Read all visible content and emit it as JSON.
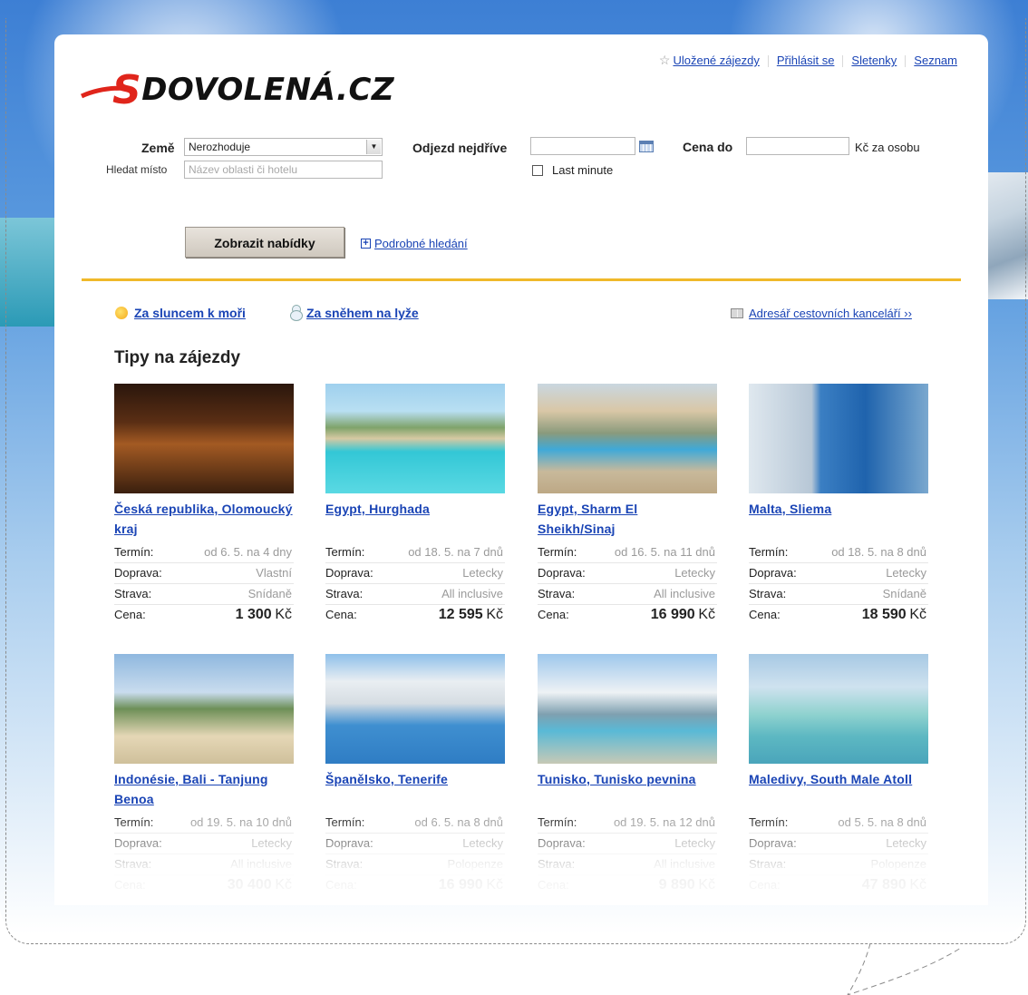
{
  "header": {
    "logo_text": "DOVOLENÁ.CZ",
    "logo_initial": "S",
    "links": [
      {
        "label": "Uložené zájezdy",
        "icon": "star-icon"
      },
      {
        "label": "Přihlásit se"
      },
      {
        "label": "Sletenky"
      },
      {
        "label": "Seznam"
      }
    ]
  },
  "search": {
    "country_label": "Země",
    "country_value": "Nerozhoduje",
    "place_label": "Hledat místo",
    "place_placeholder": "Název oblasti či hotelu",
    "departure_label": "Odjezd nejdříve",
    "departure_value": "",
    "last_minute_label": "Last minute",
    "price_label": "Cena do",
    "price_value": "",
    "price_suffix": "Kč za osobu",
    "submit_label": "Zobrazit nabídky",
    "advanced_label": "Podrobné hledání"
  },
  "categories": {
    "sun": "Za sluncem k moři",
    "snow": "Za sněhem na lyže",
    "directory": "Adresář cestovních kanceláří ››"
  },
  "tips_title": "Tipy na zájezdy",
  "row_labels": {
    "term": "Termín:",
    "transport": "Doprava:",
    "board": "Strava:",
    "price": "Cena:"
  },
  "currency": "Kč",
  "offers": [
    {
      "title": "Česká republika, Olomoucký kraj",
      "term": "od 6. 5. na 4 dny",
      "transport": "Vlastní",
      "board": "Snídaně",
      "price": "1 300",
      "image": "night-town-building"
    },
    {
      "title": "Egypt, Hurghada",
      "term": "od 18. 5. na 7 dnů",
      "transport": "Letecky",
      "board": "All inclusive",
      "price": "12 595",
      "image": "hotel-pool"
    },
    {
      "title": "Egypt, Sharm El Sheikh/Sinaj",
      "term": "od 16. 5. na 11 dnů",
      "transport": "Letecky",
      "board": "All inclusive",
      "price": "16 990",
      "image": "resort-pool-aerial"
    },
    {
      "title": "Malta, Sliema",
      "term": "od 18. 5. na 8 dnů",
      "transport": "Letecky",
      "board": "Snídaně",
      "price": "18 590",
      "image": "seaside-hotel"
    },
    {
      "title": "Indonésie, Bali - Tanjung Benoa",
      "term": "od 19. 5. na 10 dnů",
      "transport": "Letecky",
      "board": "All inclusive",
      "price": "30 400",
      "image": "beach-palms"
    },
    {
      "title": "Španělsko, Tenerife",
      "term": "od 6. 5. na 8 dnů",
      "transport": "Letecky",
      "board": "Polopenze",
      "price": "16 990",
      "image": "hotel-pool-palms"
    },
    {
      "title": "Tunisko, Tunisko pevnina",
      "term": "od 19. 5. na 12 dnů",
      "transport": "Letecky",
      "board": "All inclusive",
      "price": "9 890",
      "image": "white-resort-pool"
    },
    {
      "title": "Maledivy, South Male Atoll",
      "term": "od 5. 5. na 8 dnů",
      "transport": "Letecky",
      "board": "Polopenze",
      "price": "47 890",
      "image": "atoll-water-villas"
    }
  ]
}
